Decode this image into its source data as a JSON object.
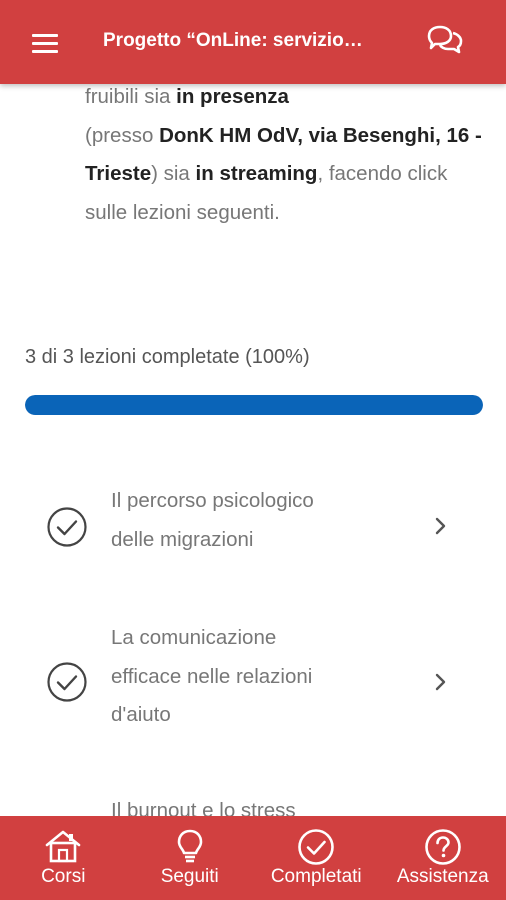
{
  "header": {
    "title": "Progetto “OnLine: servizio…",
    "menu_icon": "menu-icon",
    "chat_icon": "chat-bubbles-icon",
    "background": "#d14040"
  },
  "intro": {
    "t1": "fruibili sia ",
    "t2": "in presenza",
    "t3": "(presso ",
    "t4": "DonK HM OdV, via Besenghi, 16 - Trieste",
    "t5": ") sia ",
    "t6": "in streaming",
    "t7": ", facendo click sulle lezioni seguenti."
  },
  "progress": {
    "text": "3 di 3 lezioni completate (100%)",
    "fraction": 1.0,
    "color": "#0a64b8"
  },
  "lessons": [
    {
      "line1": "Il percorso psicologico",
      "line2": "delle migrazioni",
      "line3": "",
      "status_icon": "check-circle-icon"
    },
    {
      "line1": "La comunicazione",
      "line2": "efficace nelle relazioni",
      "line3": "d'aiuto",
      "status_icon": "check-circle-icon"
    },
    {
      "line1": "Il burnout e lo stress",
      "line2": "",
      "line3": "",
      "status_icon": "check-circle-icon"
    }
  ],
  "bottom_nav": [
    {
      "label": "Corsi",
      "icon": "home-icon"
    },
    {
      "label": "Seguiti",
      "icon": "lightbulb-icon"
    },
    {
      "label": "Completati",
      "icon": "check-circle-icon"
    },
    {
      "label": "Assistenza",
      "icon": "help-circle-icon"
    }
  ]
}
